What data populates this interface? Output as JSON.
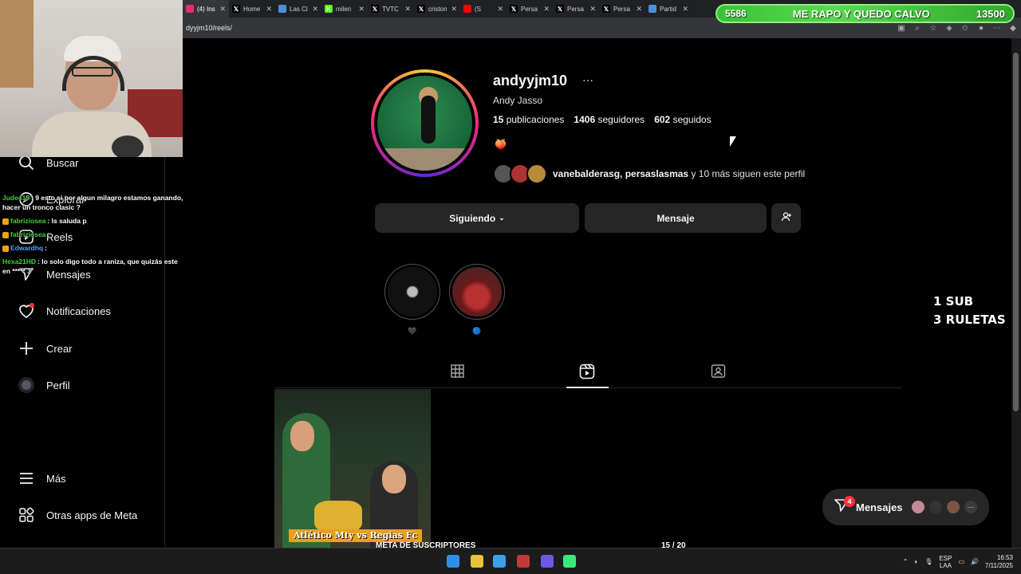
{
  "browser": {
    "tabs": [
      {
        "title": "(4) Ins",
        "icon": "instagram-icon",
        "color": "#e1306c",
        "active": true
      },
      {
        "title": "Home",
        "icon": "x-icon",
        "color": "#000000"
      },
      {
        "title": "Las Cl",
        "icon": "web-icon",
        "color": "#4a90d9"
      },
      {
        "title": "milen",
        "icon": "k-icon",
        "color": "#53fc18"
      },
      {
        "title": "TVTC",
        "icon": "x-icon",
        "color": "#000000"
      },
      {
        "title": "criston",
        "icon": "x-icon",
        "color": "#000000"
      },
      {
        "title": "(S",
        "icon": "youtube-icon",
        "color": "#ff0000"
      },
      {
        "title": "Persa",
        "icon": "x-icon",
        "color": "#000000"
      },
      {
        "title": "Persa",
        "icon": "x-icon",
        "color": "#000000"
      },
      {
        "title": "Persa",
        "icon": "x-icon",
        "color": "#000000"
      },
      {
        "title": "Partid",
        "icon": "web-icon",
        "color": "#4a90d9"
      }
    ],
    "url": "dyyjm10/reels/"
  },
  "sidebar": {
    "items": [
      {
        "label": "Buscar",
        "icon": "search-icon"
      },
      {
        "label": "Explorar",
        "icon": "compass-icon"
      },
      {
        "label": "Reels",
        "icon": "reels-icon"
      },
      {
        "label": "Mensajes",
        "icon": "messenger-icon",
        "badge": "4"
      },
      {
        "label": "Notificaciones",
        "icon": "heart-icon"
      },
      {
        "label": "Crear",
        "icon": "plus-icon"
      },
      {
        "label": "Perfil",
        "icon": "profile-avatar-icon"
      },
      {
        "label": "Más",
        "icon": "hamburger-icon"
      },
      {
        "label": "Otras apps de Meta",
        "icon": "meta-apps-icon"
      }
    ]
  },
  "chat": [
    {
      "user": "Jude415",
      "color": "#3fd33f",
      "text": ": 9 esto si por algun milagro estamos ganando, hacer un tronco clasic ?",
      "badge": false
    },
    {
      "user": "fabriziosea",
      "color": "#3fd33f",
      "text": ": ls saluda p",
      "badge": true
    },
    {
      "user": "fabriziosea",
      "color": "#3fd33f",
      "text": ":",
      "badge": true
    },
    {
      "user": "Edwardhq",
      "color": "#4aa3ff",
      "text": ":",
      "badge": true
    },
    {
      "user": "Hexa21HD",
      "color": "#3fd33f",
      "text": ": lo solo digo todo a raniza, que quizás este en ***** 3",
      "badge": false
    }
  ],
  "profile": {
    "username": "andyyjm10",
    "full_name": "Andy Jasso",
    "posts_count": "15",
    "posts_label": "publicaciones",
    "followers_count": "1406",
    "followers_label": "seguidores",
    "following_count": "602",
    "following_label": "seguidos",
    "bio_emoji": "🍑",
    "followed_by_names": "vanebalderasg, persaslasmas",
    "followed_by_rest": " y 10 más siguen este perfil"
  },
  "buttons": {
    "following": "Siguiendo",
    "message": "Mensaje"
  },
  "highlights": [
    {
      "label": "🖤"
    },
    {
      "label": "🔵"
    }
  ],
  "reel": {
    "caption": "Atlético Mty vs Regias Fc"
  },
  "overlay": {
    "sub_line1": "1 SUB",
    "sub_line2": "3 RULETAS"
  },
  "messages_pill": {
    "label": "Mensajes",
    "badge": "4"
  },
  "donation_bar": {
    "current": "5586",
    "goal_text": "ME RAPO Y QUEDO CALVO",
    "target": "13500"
  },
  "sub_goal": {
    "label": "META DE SUSCRIPTORES",
    "count": "15  / 20",
    "progress": 0.75
  },
  "taskbar": {
    "lang_top": "ESP",
    "lang_bottom": "LAA",
    "time": "16:53",
    "date": "7/11/2025"
  },
  "colors": {
    "accent_green": "#3ccf3c",
    "ig_gradient_start": "#f9ce34",
    "ig_gradient_mid": "#ee2a7b",
    "notification_red": "#ff3040"
  }
}
